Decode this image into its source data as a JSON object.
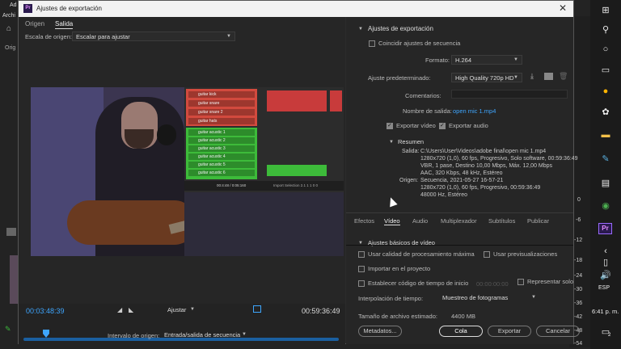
{
  "background_app": {
    "title_fragment": "Ad",
    "menu_fragment": "Archi",
    "origin_tab_fragment": "Orig"
  },
  "dialog": {
    "title": "Ajustes de exportación",
    "close_glyph": "✕"
  },
  "left": {
    "tabs": [
      "Origen",
      "Salida"
    ],
    "source_scale_label": "Escala de origen:",
    "source_scale_value": "Escalar para ajustar",
    "timecode_current": "00:03:48:39",
    "fit_label": "Ajustar",
    "timecode_end": "00:59:36:49",
    "source_range_label": "Intervalo de origen:",
    "source_range_value": "Entrada/salida de secuencia"
  },
  "video": {
    "tracks_red": [
      "guitar kick",
      "guitar snare",
      "guitar snare 2",
      "guitar hats"
    ],
    "tracks_green": [
      "guitar acustic 1",
      "guitar acustic 2",
      "guitar acustic 3",
      "guitar acustic 4",
      "guitar acustic 5",
      "guitar acustic 6"
    ],
    "transport_text": "00:4:48 / 0:05:160",
    "status_text": "Import Selection 2.1 1 1 0 0"
  },
  "export": {
    "section_title": "Ajustes de exportación",
    "match_sequence": "Coincidir ajustes de secuencia",
    "format_label": "Formato:",
    "format_value": "H.264",
    "preset_label": "Ajuste predeterminado:",
    "preset_value": "High Quality 720p HD",
    "comments_label": "Comentarios:",
    "output_name_label": "Nombre de salida:",
    "output_name_value": "open mic 1.mp4",
    "export_video": "Exportar vídeo",
    "export_audio": "Exportar audio",
    "summary_title": "Resumen",
    "output_label": "Salida:",
    "output_lines": [
      "C:\\Users\\User\\Videos\\adobe final\\open mic 1.mp4",
      "1280x720 (1,0), 60 fps, Progresivo, Solo software, 00:59:36:49",
      "VBR, 1 pase, Destino 10,00 Mbps, Máx. 12,00 Mbps",
      "AAC, 320 Kbps, 48 kHz, Estéreo"
    ],
    "source_label": "Origen:",
    "source_lines": [
      "Secuencia, 2021-05-27 16-57-21",
      "1280x720 (1,0), 60 fps, Progresivo, 00:59:36:49",
      "48000 Hz, Estéreo"
    ]
  },
  "tabs": [
    "Efectos",
    "Vídeo",
    "Audio",
    "Multiplexador",
    "Subtítulos",
    "Publicar"
  ],
  "active_tab": "Vídeo",
  "video_basic": "Ajustes básicos de vídeo",
  "options": {
    "max_quality": "Usar calidad de procesamiento máxima",
    "use_previews": "Usar previsualizaciones",
    "import_project": "Importar en el proyecto",
    "set_timecode": "Establecer código de tiempo de inicio",
    "timecode_placeholder": "00:00:00:00",
    "alpha_only": "Representar solo canal alfa",
    "interp_label": "Interpolación de tiempo:",
    "interp_value": "Muestreo de fotogramas",
    "filesize_label": "Tamaño de archivo estimado:",
    "filesize_value": "4400 MB"
  },
  "buttons": {
    "metadata": "Metadatos...",
    "queue": "Cola",
    "export": "Exportar",
    "cancel": "Cancelar"
  },
  "strip_numbers": [
    "0",
    "-6",
    "-12",
    "-18",
    "-24",
    "-30",
    "-36",
    "-42",
    "-48",
    "-54"
  ],
  "taskbar": {
    "lang": "ESP",
    "time": "6:41 p. m.",
    "notif_count": "2",
    "premiere": "Pr"
  }
}
